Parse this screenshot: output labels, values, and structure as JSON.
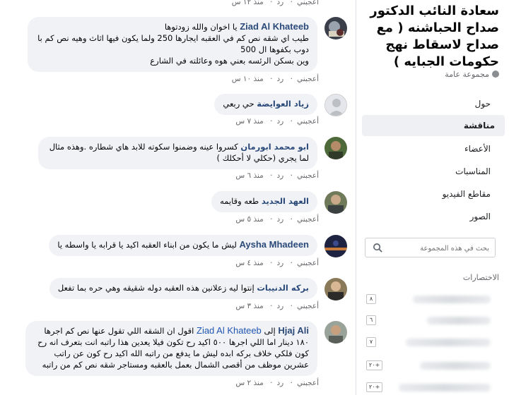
{
  "comments": [
    {
      "meta_like": "أعجبني",
      "meta_reply": "رد",
      "meta_time": "منذ ١٢ س"
    },
    {
      "author": "Ziad Al Khateeb",
      "lines": [
        "يا اخوان والله زودتوها",
        "طيب اي شقه نص كم في العقبه ايجارها 250 ولما يكون فيها اثاث وهيه نص كم با دوب بكفوها ال 500",
        "وين بسكن الرئسه بعني هوه وعائلته في الشارع"
      ],
      "meta_like": "أعجبني",
      "meta_reply": "رد",
      "meta_time": "منذ ١٠ س"
    },
    {
      "author": "زياد العوايضة",
      "text": "حي ربعي",
      "meta_like": "أعجبني",
      "meta_reply": "رد",
      "meta_time": "منذ ٧ س"
    },
    {
      "author": "ابو محمد ابورمان",
      "text": "كسروا عينه وضمنوا سكوته للابد هاي شطاره .وهذه مثال لما يجري (حكلي لا أحكلك )",
      "meta_like": "أعجبني",
      "meta_reply": "رد",
      "meta_time": "منذ ٦ س"
    },
    {
      "author": "العهد الجديد",
      "text": "طعه وقايمه",
      "meta_like": "أعجبني",
      "meta_reply": "رد",
      "meta_time": "منذ ٥ س"
    },
    {
      "author": "Aysha Mhadeen",
      "text": "ليش ما يكون من ابناء العقبه اكيد يا قرابه يا واسطه يا",
      "meta_like": "أعجبني",
      "meta_reply": "رد",
      "meta_time": "منذ ٤ س"
    },
    {
      "author": "بركه الدنيبات",
      "text": "إنتوا ليه زعلانين هذه العقبه دوله شقيقه وهي حره بما تفعل",
      "meta_like": "أعجبني",
      "meta_reply": "رد",
      "meta_time": "منذ ٣ س"
    },
    {
      "author": "Hjaj Ali",
      "reply_to_prefix": "إلى",
      "reply_to": "Ziad Al Khateeb",
      "text": "اقول ان الشقه اللي تقول عنها نص كم اجرها ١٨٠ دينار اما اللي اجرها ٥٠٠ اكيد رح تكون فيلا يعدين هذا راتبه انت بتعرف انه رح كون فلكي خلاف بركه ابده ليش ما يدفع من راتبه الله اكيد رح كون عن راتب عشرين موظف من أقصى الشمال بعمل بالعقبه ومستاجر شقه نص كم من راتبه",
      "meta_like": "أعجبني",
      "meta_reply": "رد",
      "meta_time": "منذ ٢ س"
    }
  ],
  "sidebar": {
    "group_title": "سعادة النائب الدكتور صداح الحباشنه ( مع صداح لاسقاط نهج حكومات الجبايه )",
    "group_type": "مجموعة عامة",
    "nav": [
      "حول",
      "مناقشة",
      "الأعضاء",
      "المناسبات",
      "مقاطع الفيديو",
      "الصور"
    ],
    "active_nav": "مناقشة",
    "search_placeholder": "بحث في هذه المجموعة",
    "shortcuts_title": "الاختصارات",
    "shortcut_counts": [
      "٨",
      "٦",
      "٧",
      "٢٠+",
      "٢٠+"
    ]
  },
  "colors": {
    "accent": "#1877f2",
    "author": "#2b4a7a",
    "meta": "#65676b"
  }
}
